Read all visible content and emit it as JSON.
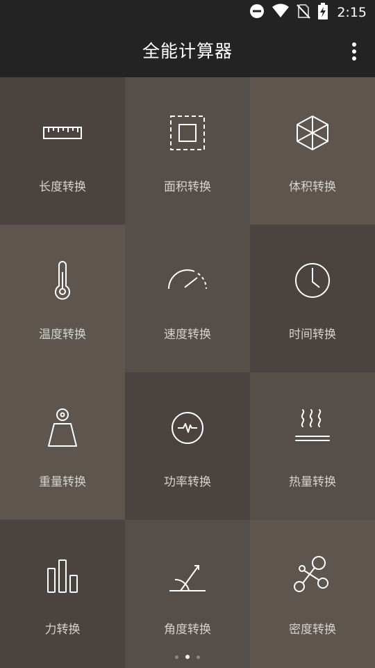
{
  "status_bar": {
    "time": "2:15"
  },
  "app_bar": {
    "title": "全能计算器"
  },
  "tiles": [
    {
      "label": "长度转换",
      "icon": "ruler-icon"
    },
    {
      "label": "面积转换",
      "icon": "area-square-icon"
    },
    {
      "label": "体积转换",
      "icon": "cube-icon"
    },
    {
      "label": "温度转换",
      "icon": "thermometer-icon"
    },
    {
      "label": "速度转换",
      "icon": "speedometer-icon"
    },
    {
      "label": "时间转换",
      "icon": "clock-icon"
    },
    {
      "label": "重量转换",
      "icon": "weight-icon"
    },
    {
      "label": "功率转换",
      "icon": "power-pulse-icon"
    },
    {
      "label": "热量转换",
      "icon": "heat-waves-icon"
    },
    {
      "label": "力转换",
      "icon": "bar-chart-icon"
    },
    {
      "label": "角度转换",
      "icon": "angle-icon"
    },
    {
      "label": "密度转换",
      "icon": "molecule-icon"
    }
  ],
  "pagination": {
    "total": 3,
    "active": 2
  },
  "colors": {
    "bar_bg": "#232323",
    "tile_dark": "#4b4340",
    "tile_mid": "#564e48",
    "tile_light": "#5d554e",
    "label_text": "#d6d2cd"
  }
}
